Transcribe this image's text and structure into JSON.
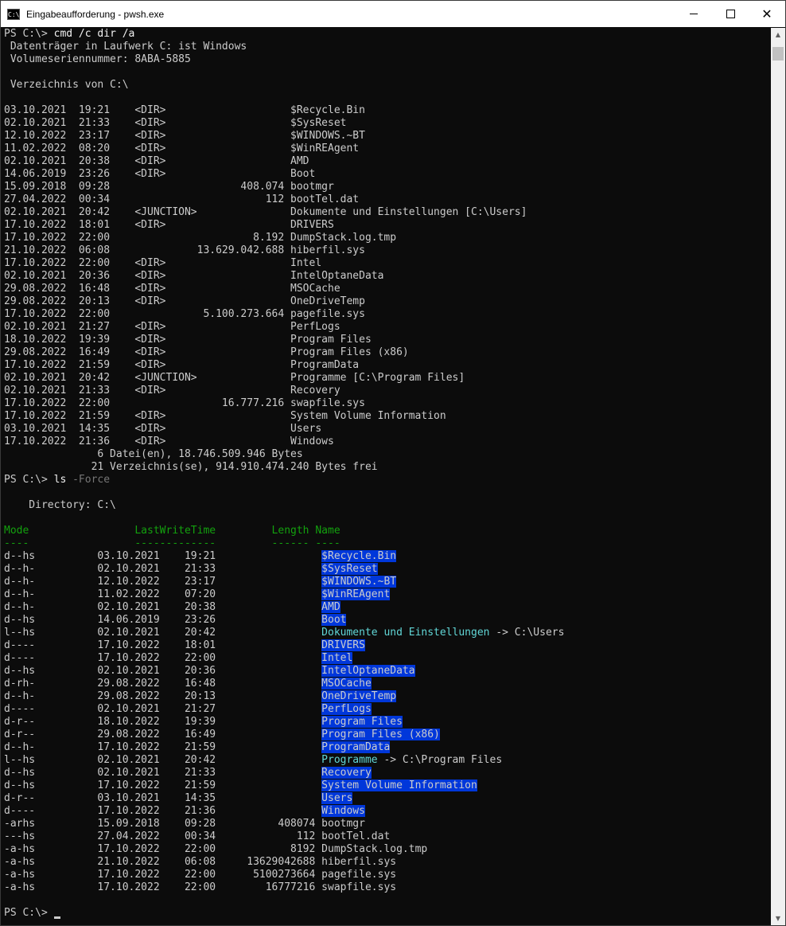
{
  "window": {
    "title": "Eingabeaufforderung - pwsh.exe",
    "icon_label": "C:\\",
    "controls": {
      "minimize_icon": "minimize-icon",
      "maximize_icon": "maximize-icon",
      "close_icon": "close-icon",
      "close_glyph": "✕"
    }
  },
  "console": {
    "cmd_dir": {
      "prompt": "PS C:\\> ",
      "command": "cmd /c dir /a",
      "header_lines": [
        " Datenträger in Laufwerk C: ist Windows",
        " Volumeseriennummer: 8ABA-5885",
        "",
        " Verzeichnis von C:\\",
        ""
      ],
      "entries": [
        {
          "date": "03.10.2021",
          "time": "19:21",
          "type": "<DIR>",
          "size": "",
          "name": "$Recycle.Bin"
        },
        {
          "date": "02.10.2021",
          "time": "21:33",
          "type": "<DIR>",
          "size": "",
          "name": "$SysReset"
        },
        {
          "date": "12.10.2022",
          "time": "23:17",
          "type": "<DIR>",
          "size": "",
          "name": "$WINDOWS.~BT"
        },
        {
          "date": "11.02.2022",
          "time": "08:20",
          "type": "<DIR>",
          "size": "",
          "name": "$WinREAgent"
        },
        {
          "date": "02.10.2021",
          "time": "20:38",
          "type": "<DIR>",
          "size": "",
          "name": "AMD"
        },
        {
          "date": "14.06.2019",
          "time": "23:26",
          "type": "<DIR>",
          "size": "",
          "name": "Boot"
        },
        {
          "date": "15.09.2018",
          "time": "09:28",
          "type": "",
          "size": "408.074",
          "name": "bootmgr"
        },
        {
          "date": "27.04.2022",
          "time": "00:34",
          "type": "",
          "size": "112",
          "name": "bootTel.dat"
        },
        {
          "date": "02.10.2021",
          "time": "20:42",
          "type": "<JUNCTION>",
          "size": "",
          "name": "Dokumente und Einstellungen [C:\\Users]"
        },
        {
          "date": "17.10.2022",
          "time": "18:01",
          "type": "<DIR>",
          "size": "",
          "name": "DRIVERS"
        },
        {
          "date": "17.10.2022",
          "time": "22:00",
          "type": "",
          "size": "8.192",
          "name": "DumpStack.log.tmp"
        },
        {
          "date": "21.10.2022",
          "time": "06:08",
          "type": "",
          "size": "13.629.042.688",
          "name": "hiberfil.sys"
        },
        {
          "date": "17.10.2022",
          "time": "22:00",
          "type": "<DIR>",
          "size": "",
          "name": "Intel"
        },
        {
          "date": "02.10.2021",
          "time": "20:36",
          "type": "<DIR>",
          "size": "",
          "name": "IntelOptaneData"
        },
        {
          "date": "29.08.2022",
          "time": "16:48",
          "type": "<DIR>",
          "size": "",
          "name": "MSOCache"
        },
        {
          "date": "29.08.2022",
          "time": "20:13",
          "type": "<DIR>",
          "size": "",
          "name": "OneDriveTemp"
        },
        {
          "date": "17.10.2022",
          "time": "22:00",
          "type": "",
          "size": "5.100.273.664",
          "name": "pagefile.sys"
        },
        {
          "date": "02.10.2021",
          "time": "21:27",
          "type": "<DIR>",
          "size": "",
          "name": "PerfLogs"
        },
        {
          "date": "18.10.2022",
          "time": "19:39",
          "type": "<DIR>",
          "size": "",
          "name": "Program Files"
        },
        {
          "date": "29.08.2022",
          "time": "16:49",
          "type": "<DIR>",
          "size": "",
          "name": "Program Files (x86)"
        },
        {
          "date": "17.10.2022",
          "time": "21:59",
          "type": "<DIR>",
          "size": "",
          "name": "ProgramData"
        },
        {
          "date": "02.10.2021",
          "time": "20:42",
          "type": "<JUNCTION>",
          "size": "",
          "name": "Programme [C:\\Program Files]"
        },
        {
          "date": "02.10.2021",
          "time": "21:33",
          "type": "<DIR>",
          "size": "",
          "name": "Recovery"
        },
        {
          "date": "17.10.2022",
          "time": "22:00",
          "type": "",
          "size": "16.777.216",
          "name": "swapfile.sys"
        },
        {
          "date": "17.10.2022",
          "time": "21:59",
          "type": "<DIR>",
          "size": "",
          "name": "System Volume Information"
        },
        {
          "date": "03.10.2021",
          "time": "14:35",
          "type": "<DIR>",
          "size": "",
          "name": "Users"
        },
        {
          "date": "17.10.2022",
          "time": "21:36",
          "type": "<DIR>",
          "size": "",
          "name": "Windows"
        }
      ],
      "summary_files": "               6 Datei(en), 18.746.509.946 Bytes",
      "summary_dirs": "              21 Verzeichnis(se), 914.910.474.240 Bytes frei"
    },
    "ls": {
      "prompt": "PS C:\\> ",
      "command": "ls",
      "parameter": "-Force",
      "directory_line": "    Directory: C:\\",
      "headers": {
        "mode": "Mode",
        "lastwrite": "LastWriteTime",
        "length": "Length",
        "name": "Name"
      },
      "underlines": {
        "mode": "----",
        "lastwrite": "-------------",
        "length": "------",
        "name": "----"
      },
      "entries": [
        {
          "mode": "d--hs",
          "date": "03.10.2021",
          "time": "19:21",
          "length": "",
          "name": "$Recycle.Bin",
          "kind": "dir"
        },
        {
          "mode": "d--h-",
          "date": "02.10.2021",
          "time": "21:33",
          "length": "",
          "name": "$SysReset",
          "kind": "dir"
        },
        {
          "mode": "d--h-",
          "date": "12.10.2022",
          "time": "23:17",
          "length": "",
          "name": "$WINDOWS.~BT",
          "kind": "dir"
        },
        {
          "mode": "d--h-",
          "date": "11.02.2022",
          "time": "07:20",
          "length": "",
          "name": "$WinREAgent",
          "kind": "dir"
        },
        {
          "mode": "d--h-",
          "date": "02.10.2021",
          "time": "20:38",
          "length": "",
          "name": "AMD",
          "kind": "dir"
        },
        {
          "mode": "d--hs",
          "date": "14.06.2019",
          "time": "23:26",
          "length": "",
          "name": "Boot",
          "kind": "dir"
        },
        {
          "mode": "l--hs",
          "date": "02.10.2021",
          "time": "20:42",
          "length": "",
          "name": "Dokumente und Einstellungen",
          "target": " -> C:\\Users",
          "kind": "link"
        },
        {
          "mode": "d----",
          "date": "17.10.2022",
          "time": "18:01",
          "length": "",
          "name": "DRIVERS",
          "kind": "dir"
        },
        {
          "mode": "d----",
          "date": "17.10.2022",
          "time": "22:00",
          "length": "",
          "name": "Intel",
          "kind": "dir"
        },
        {
          "mode": "d--hs",
          "date": "02.10.2021",
          "time": "20:36",
          "length": "",
          "name": "IntelOptaneData",
          "kind": "dir"
        },
        {
          "mode": "d-rh-",
          "date": "29.08.2022",
          "time": "16:48",
          "length": "",
          "name": "MSOCache",
          "kind": "dir"
        },
        {
          "mode": "d--h-",
          "date": "29.08.2022",
          "time": "20:13",
          "length": "",
          "name": "OneDriveTemp",
          "kind": "dir"
        },
        {
          "mode": "d----",
          "date": "02.10.2021",
          "time": "21:27",
          "length": "",
          "name": "PerfLogs",
          "kind": "dir"
        },
        {
          "mode": "d-r--",
          "date": "18.10.2022",
          "time": "19:39",
          "length": "",
          "name": "Program Files",
          "kind": "dir"
        },
        {
          "mode": "d-r--",
          "date": "29.08.2022",
          "time": "16:49",
          "length": "",
          "name": "Program Files (x86)",
          "kind": "dir"
        },
        {
          "mode": "d--h-",
          "date": "17.10.2022",
          "time": "21:59",
          "length": "",
          "name": "ProgramData",
          "kind": "dir"
        },
        {
          "mode": "l--hs",
          "date": "02.10.2021",
          "time": "20:42",
          "length": "",
          "name": "Programme",
          "target": " -> C:\\Program Files",
          "kind": "link"
        },
        {
          "mode": "d--hs",
          "date": "02.10.2021",
          "time": "21:33",
          "length": "",
          "name": "Recovery",
          "kind": "dir"
        },
        {
          "mode": "d--hs",
          "date": "17.10.2022",
          "time": "21:59",
          "length": "",
          "name": "System Volume Information",
          "kind": "dir"
        },
        {
          "mode": "d-r--",
          "date": "03.10.2021",
          "time": "14:35",
          "length": "",
          "name": "Users",
          "kind": "dir"
        },
        {
          "mode": "d----",
          "date": "17.10.2022",
          "time": "21:36",
          "length": "",
          "name": "Windows",
          "kind": "dir"
        },
        {
          "mode": "-arhs",
          "date": "15.09.2018",
          "time": "09:28",
          "length": "408074",
          "name": "bootmgr",
          "kind": "file"
        },
        {
          "mode": "---hs",
          "date": "27.04.2022",
          "time": "00:34",
          "length": "112",
          "name": "bootTel.dat",
          "kind": "file"
        },
        {
          "mode": "-a-hs",
          "date": "17.10.2022",
          "time": "22:00",
          "length": "8192",
          "name": "DumpStack.log.tmp",
          "kind": "file"
        },
        {
          "mode": "-a-hs",
          "date": "21.10.2022",
          "time": "06:08",
          "length": "13629042688",
          "name": "hiberfil.sys",
          "kind": "file"
        },
        {
          "mode": "-a-hs",
          "date": "17.10.2022",
          "time": "22:00",
          "length": "5100273664",
          "name": "pagefile.sys",
          "kind": "file"
        },
        {
          "mode": "-a-hs",
          "date": "17.10.2022",
          "time": "22:00",
          "length": "16777216",
          "name": "swapfile.sys",
          "kind": "file"
        }
      ]
    },
    "final_prompt": "PS C:\\> ",
    "colors": {
      "background": "#0c0c0c",
      "foreground": "#cccccc",
      "header_green": "#13a10e",
      "dir_highlight": "#0037da",
      "link_cyan": "#61d6d6",
      "param_gray": "#767676"
    }
  },
  "scrollbar": {
    "up_arrow": "▲",
    "down_arrow": "▼"
  }
}
